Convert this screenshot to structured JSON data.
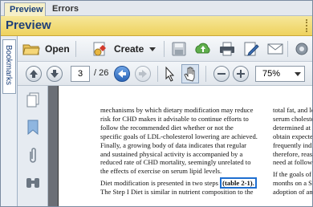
{
  "tabs": [
    {
      "label": "Preview",
      "active": true
    },
    {
      "label": "Errors",
      "active": false
    }
  ],
  "pane": {
    "title": "Preview"
  },
  "sidebar": {
    "bookmarks_label": "Bookmarks"
  },
  "toolbar": {
    "open_label": "Open",
    "create_label": "Create"
  },
  "nav": {
    "current_page": "3",
    "total_pages": "/ 26",
    "zoom": "75%"
  },
  "document": {
    "left_column_lines": [
      "mechanisms by which dietary modification may reduce",
      "risk for CHD makes it advisable to continue efforts to",
      "follow the recommended diet whether or not the",
      "specific goals of LDL-cholesterol lowering are achieved.",
      "Finally, a growing body of data indicates that regular",
      "and sustained physical activity is accompanied by a",
      "reduced rate of CHD mortality, seemingly unrelated to",
      "the effects of exercise on serum lipid levels."
    ],
    "para2_prefix": "Diet modification is presented in two steps ",
    "table_ref": "(table 2-1).",
    "para2_line2": "The Step I Diet is similar in nutrient composition to the",
    "right_column_lines": [
      "total fat, and less t",
      "serum cholesterol",
      "determined at 4-6",
      "obtain expected se",
      "frequently indicate",
      "therefore, reassess",
      "need at followup"
    ],
    "right_para2_lines": [
      "If the goals of ther",
      "months on a Step",
      "adoption of and ad"
    ]
  },
  "colors": {
    "header_yellow": "#eed25e",
    "title_blue": "#1f3f78",
    "highlight_blue": "#1f6fd0",
    "doc_background": "#6b6f76"
  },
  "icons": [
    "folder-icon",
    "create-icon",
    "save-icon",
    "upload-icon",
    "print-icon",
    "edit-icon",
    "email-icon",
    "gear-icon",
    "arrow-up-icon",
    "arrow-down-icon",
    "back-icon",
    "forward-icon",
    "select-cursor-icon",
    "hand-icon",
    "zoom-out-icon",
    "zoom-in-icon",
    "pages-icon",
    "bookmark-icon",
    "attachment-icon",
    "binoculars-icon"
  ]
}
